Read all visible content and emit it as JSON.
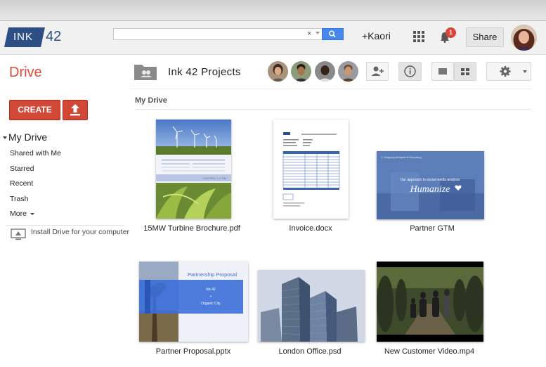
{
  "header": {
    "logo_text_1": "INK",
    "logo_text_2": "42",
    "search_clear": "×",
    "user_link": "+Kaori",
    "notification_count": "1",
    "share_label": "Share"
  },
  "drive": {
    "title": "Drive",
    "folder_name": "Ink 42 Projects"
  },
  "sidebar": {
    "create_label": "CREATE",
    "my_drive_label": "My Drive",
    "items": [
      {
        "label": "Shared with Me"
      },
      {
        "label": "Starred"
      },
      {
        "label": "Recent"
      },
      {
        "label": "Trash"
      },
      {
        "label": "More"
      }
    ],
    "install_label": "Install Drive for your computer"
  },
  "main": {
    "section_title": "My Drive",
    "files": [
      {
        "name": "15MW Turbine Brochure.pdf"
      },
      {
        "name": "Invoice.docx"
      },
      {
        "name": "Partner GTM"
      },
      {
        "name": "Partner Proposal.pptx"
      },
      {
        "name": "London Office.psd"
      },
      {
        "name": "New Customer Video.mp4"
      }
    ]
  },
  "thumbnails": {
    "gtm_headline": "Our approach to social media analysis",
    "gtm_brand": "Humanize",
    "gtm_topline": "1. Ongoing Analysis & Reporting",
    "proposal_title": "Partnership Proposal",
    "proposal_line_1": "Ink 42",
    "proposal_line_2": "+",
    "proposal_line_3": "Organic City",
    "turbine_caption": "CONTROL 1.1 TIM"
  },
  "colors": {
    "brand": "#2d4f86",
    "drive_red": "#dd4b39",
    "create_red": "#d14836",
    "search_blue": "#4787ed"
  }
}
